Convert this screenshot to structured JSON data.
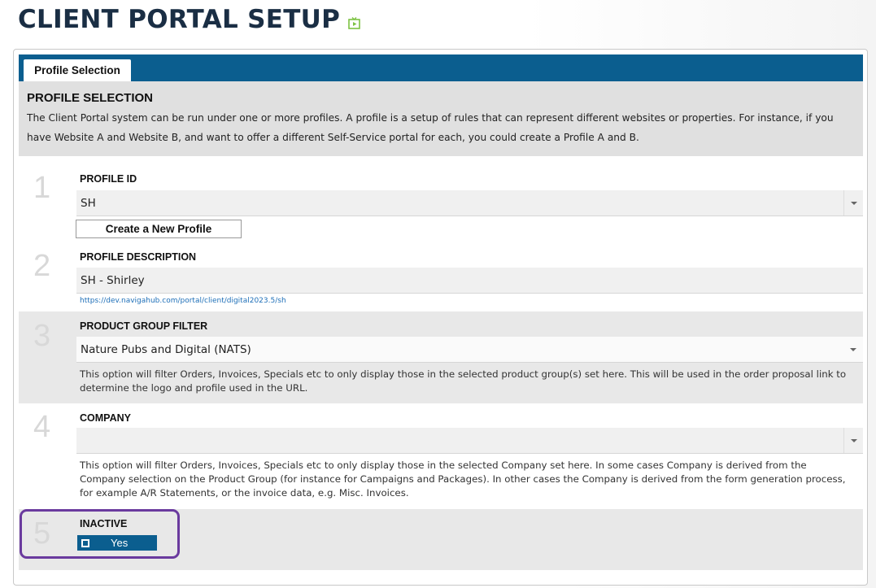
{
  "page": {
    "title": "CLIENT PORTAL SETUP"
  },
  "tabs": [
    {
      "label": "Profile Selection",
      "active": true
    }
  ],
  "intro": {
    "heading": "PROFILE SELECTION",
    "text": "The Client Portal system can be run under one or more profiles. A profile is a setup of rules that can represent different websites or properties. For instance, if you have Website A and Website B, and want to offer a different Self-Service portal for each, you could create a Profile A and B."
  },
  "steps": {
    "profile_id": {
      "number": "1",
      "label": "PROFILE ID",
      "value": "SH",
      "create_button": "Create a New Profile"
    },
    "profile_description": {
      "number": "2",
      "label": "PROFILE DESCRIPTION",
      "value": "SH - Shirley",
      "url": "https://dev.navigahub.com/portal/client/digital2023.5/sh"
    },
    "product_group_filter": {
      "number": "3",
      "label": "PRODUCT GROUP FILTER",
      "value": "Nature Pubs and Digital (NATS)",
      "help": "This option will filter Orders, Invoices, Specials etc to only display those in the selected product group(s) set here. This will be used in the order proposal link to determine the logo and profile used in the URL."
    },
    "company": {
      "number": "4",
      "label": "COMPANY",
      "value": "",
      "help": "This option will filter Orders, Invoices, Specials etc to only display those in the selected Company set here. In some cases Company is derived from the Company selection on the Product Group (for instance for Campaigns and Packages). In other cases the Company is derived from the form generation process, for example A/R Statements, or the invoice data, e.g. Misc. Invoices."
    },
    "inactive": {
      "number": "5",
      "label": "INACTIVE",
      "toggle_label": "Yes"
    }
  },
  "colors": {
    "brand_blue": "#0b5e8f",
    "title_navy": "#1a2e44",
    "highlight_purple": "#6a3a9e",
    "link_blue": "#1e6fb8"
  }
}
